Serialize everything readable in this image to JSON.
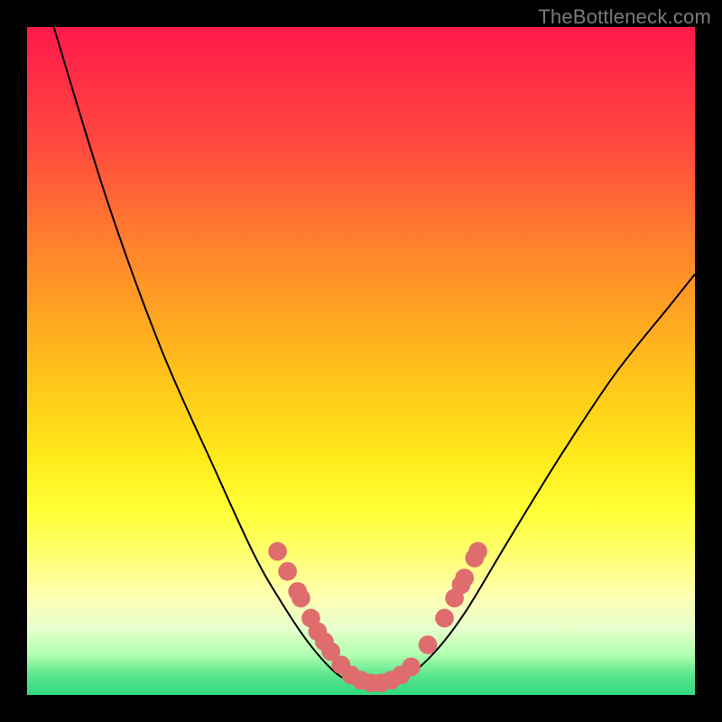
{
  "watermark": "TheBottleneck.com",
  "colors": {
    "marker": "#e06d6d",
    "curve": "#000000",
    "frame": "#000000"
  },
  "chart_data": {
    "type": "line",
    "title": "",
    "xlabel": "",
    "ylabel": "",
    "xlim": [
      0,
      100
    ],
    "ylim": [
      0,
      100
    ],
    "note": "Axes are unlabeled; values below are percentages of the plot area (0,0 = top-left of colored region). Curve is a V-shaped bottleneck curve.",
    "series": [
      {
        "name": "bottleneck-curve",
        "points": [
          {
            "x": 4,
            "y": 0
          },
          {
            "x": 12,
            "y": 26
          },
          {
            "x": 20,
            "y": 48
          },
          {
            "x": 28,
            "y": 66
          },
          {
            "x": 34,
            "y": 79
          },
          {
            "x": 38,
            "y": 86
          },
          {
            "x": 42,
            "y": 92
          },
          {
            "x": 46,
            "y": 96.5
          },
          {
            "x": 49,
            "y": 98.2
          },
          {
            "x": 52,
            "y": 98.5
          },
          {
            "x": 55,
            "y": 98.2
          },
          {
            "x": 58,
            "y": 96.5
          },
          {
            "x": 62,
            "y": 92.5
          },
          {
            "x": 66,
            "y": 87
          },
          {
            "x": 72,
            "y": 77
          },
          {
            "x": 80,
            "y": 64
          },
          {
            "x": 88,
            "y": 52
          },
          {
            "x": 96,
            "y": 42
          },
          {
            "x": 100,
            "y": 37
          }
        ]
      }
    ],
    "markers": {
      "name": "highlighted-points",
      "points": [
        {
          "x": 37.5,
          "y": 78.5
        },
        {
          "x": 39.0,
          "y": 81.5
        },
        {
          "x": 40.5,
          "y": 84.5
        },
        {
          "x": 41.0,
          "y": 85.5
        },
        {
          "x": 42.5,
          "y": 88.5
        },
        {
          "x": 43.5,
          "y": 90.5
        },
        {
          "x": 44.5,
          "y": 92.0
        },
        {
          "x": 45.5,
          "y": 93.5
        },
        {
          "x": 47.0,
          "y": 95.5
        },
        {
          "x": 48.5,
          "y": 97.0
        },
        {
          "x": 50.0,
          "y": 97.8
        },
        {
          "x": 51.5,
          "y": 98.2
        },
        {
          "x": 53.0,
          "y": 98.2
        },
        {
          "x": 54.5,
          "y": 97.8
        },
        {
          "x": 56.0,
          "y": 97.0
        },
        {
          "x": 57.5,
          "y": 95.8
        },
        {
          "x": 60.0,
          "y": 92.5
        },
        {
          "x": 62.5,
          "y": 88.5
        },
        {
          "x": 64.0,
          "y": 85.5
        },
        {
          "x": 65.0,
          "y": 83.5
        },
        {
          "x": 65.5,
          "y": 82.5
        },
        {
          "x": 67.0,
          "y": 79.5
        },
        {
          "x": 67.5,
          "y": 78.5
        }
      ],
      "radius_pct": 1.4
    }
  }
}
